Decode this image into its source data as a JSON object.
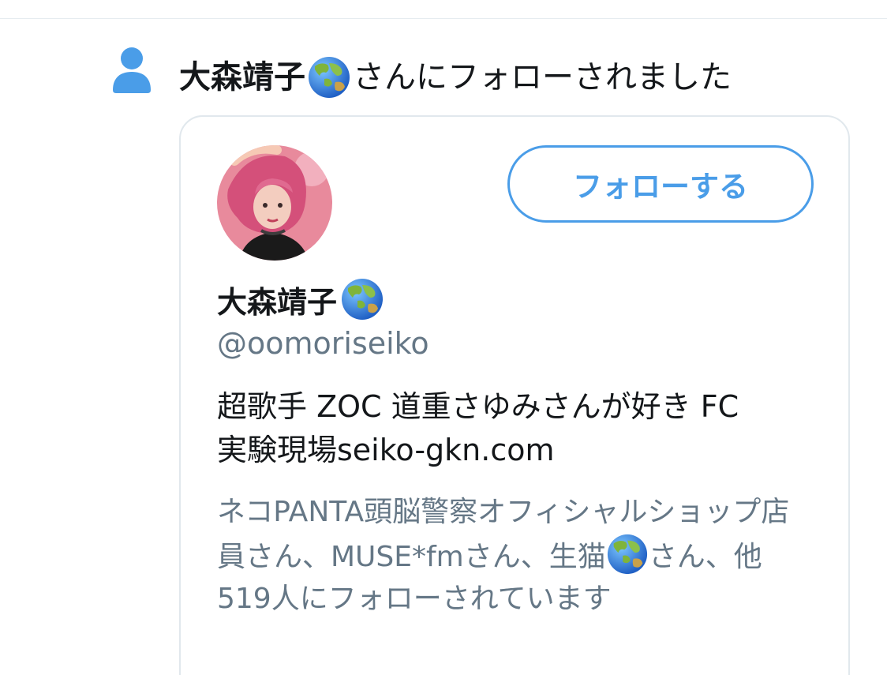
{
  "notification": {
    "name": "大森靖子",
    "name_emoji": "globe-asia-australia-emoji",
    "suffix": "さんにフォローされました"
  },
  "card": {
    "follow_button_label": "フォローする",
    "display_name": "大森靖子",
    "handle": "@oomoriseiko",
    "bio_line1": "超歌手 ZOC 道重さゆみさんが好き FC",
    "bio_line2": "実験現場seiko-gkn.com",
    "followed_by_part1": "ネコPANTA頭脳警察オフィシャルショップ店員さん、MUSE*fmさん、生猫",
    "followed_by_part2": "さん、他519人にフォローされています"
  },
  "colors": {
    "accent": "#4a9de8",
    "secondary_text": "#657786",
    "border": "#e1e8ed",
    "avatar_background": "#e88a9c"
  }
}
